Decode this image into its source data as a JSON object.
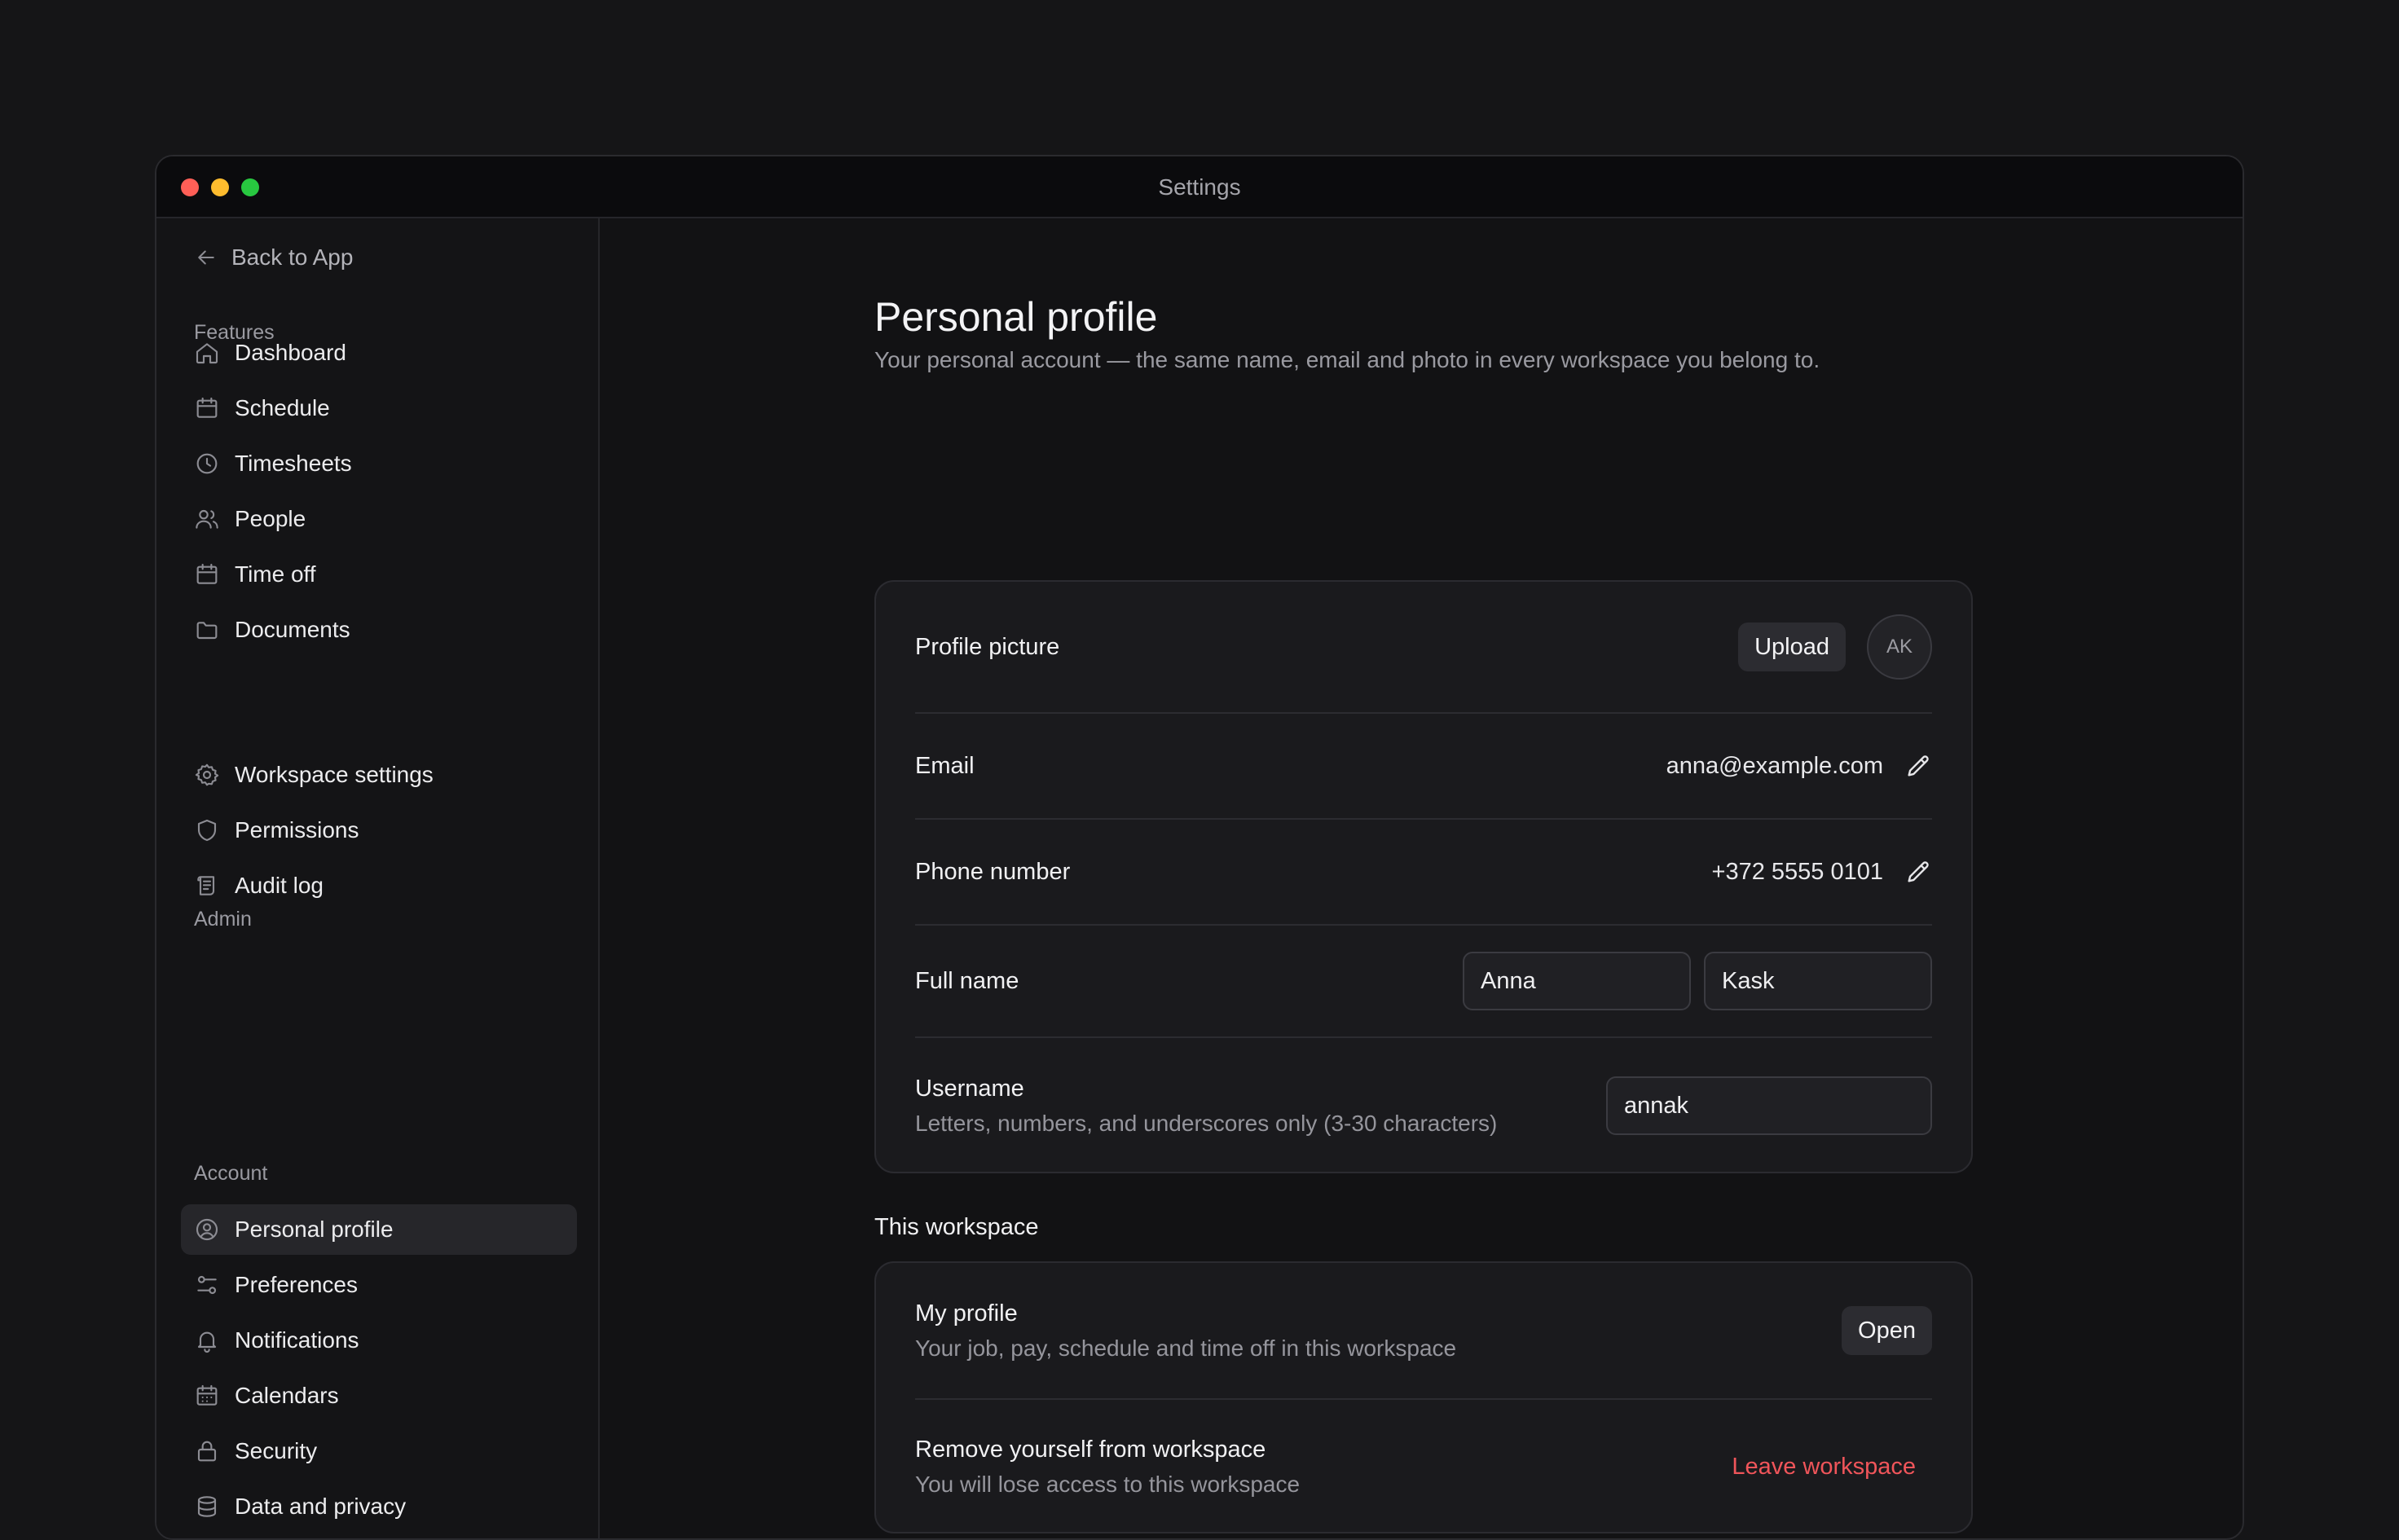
{
  "window": {
    "title": "Settings"
  },
  "sidebar": {
    "back_label": "Back to App",
    "sections": [
      {
        "label": "Features",
        "items": [
          "Dashboard",
          "Schedule",
          "Timesheets",
          "People",
          "Time off",
          "Documents"
        ]
      },
      {
        "label": "Admin",
        "items": [
          "Workspace settings",
          "Permissions",
          "Audit log"
        ]
      },
      {
        "label": "Account",
        "items": [
          "Personal profile",
          "Preferences",
          "Notifications",
          "Calendars",
          "Security",
          "Data and privacy"
        ]
      }
    ],
    "active_item": "Personal profile"
  },
  "page": {
    "title": "Personal profile",
    "subtitle": "Your personal account — the same name, email and photo in every workspace you belong to."
  },
  "profile": {
    "picture_label": "Profile picture",
    "upload_label": "Upload",
    "avatar_initials": "AK",
    "email_label": "Email",
    "email_value": "anna@example.com",
    "phone_label": "Phone number",
    "phone_value": "+372 5555 0101",
    "fullname_label": "Full name",
    "first_name": "Anna",
    "last_name": "Kask",
    "username_label": "Username",
    "username_hint": "Letters, numbers, and underscores only (3-30 characters)",
    "username_value": "annak"
  },
  "workspace": {
    "section_title": "This workspace",
    "my_profile_label": "My profile",
    "my_profile_hint": "Your job, pay, schedule and time off in this workspace",
    "open_label": "Open",
    "remove_label": "Remove yourself from workspace",
    "remove_hint": "You will lose access to this workspace",
    "leave_label": "Leave workspace"
  },
  "colors": {
    "background": "#151517",
    "card": "#1a1a1d",
    "danger": "#f0555a",
    "traffic_red": "#ff5f57",
    "traffic_yellow": "#febc2e",
    "traffic_green": "#28c840"
  }
}
